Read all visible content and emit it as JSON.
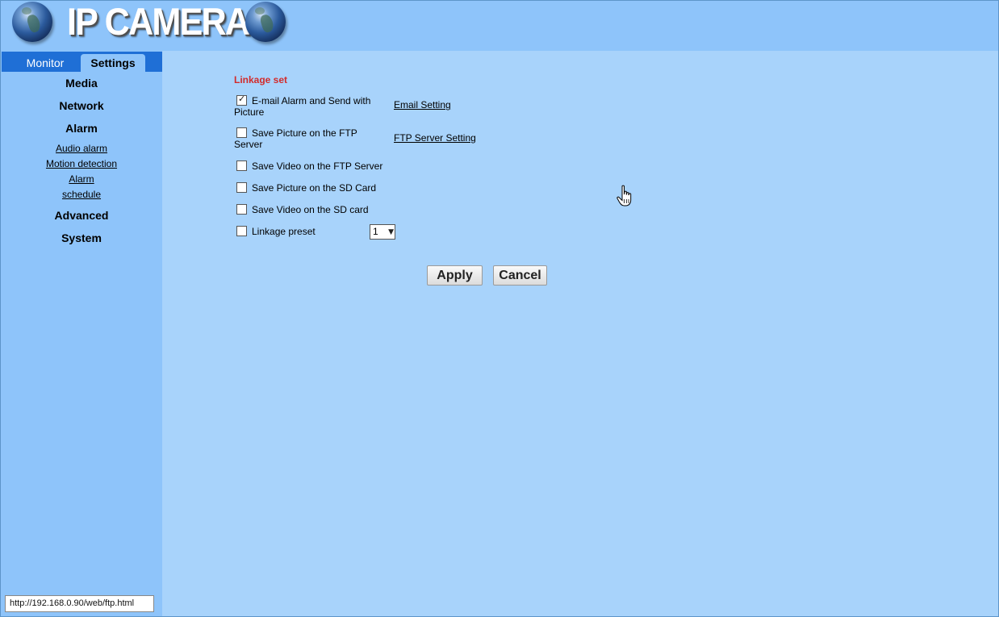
{
  "header": {
    "brand": "IP CAMERA",
    "left_icon": "globe-icon",
    "right_icon": "globe-icon"
  },
  "sidebar": {
    "tabs": [
      {
        "label": "Monitor",
        "active": false
      },
      {
        "label": "Settings",
        "active": true
      }
    ],
    "items": [
      {
        "label": "Media",
        "type": "main"
      },
      {
        "label": "Network",
        "type": "main"
      },
      {
        "label": "Alarm",
        "type": "main"
      },
      {
        "label": "Audio alarm",
        "type": "sub"
      },
      {
        "label": "Motion detection",
        "type": "sub"
      },
      {
        "label": "Alarm",
        "type": "sub"
      },
      {
        "label": "schedule",
        "type": "sub"
      },
      {
        "label": "Advanced",
        "type": "main"
      },
      {
        "label": "System",
        "type": "main"
      }
    ]
  },
  "main": {
    "section_title": "Linkage set",
    "options": [
      {
        "label_line1": "E-mail Alarm and Send with",
        "label_line2": "Picture",
        "checked": true
      },
      {
        "label_line1": "Save Picture on the FTP",
        "label_line2": "Server",
        "checked": false
      },
      {
        "label_line1": "Save Video on the FTP Server",
        "label_line2": "",
        "checked": false
      },
      {
        "label_line1": "Save Picture on the SD Card",
        "label_line2": "",
        "checked": false
      },
      {
        "label_line1": "Save Video on the SD card",
        "label_line2": "",
        "checked": false
      },
      {
        "label_line1": "Linkage preset",
        "label_line2": "",
        "checked": false
      }
    ],
    "links": {
      "email_setting": "Email Setting",
      "ftp_server_setting": "FTP Server Setting"
    },
    "preset_select": {
      "value": "1",
      "arrow_icon": "dropdown-arrow-icon"
    },
    "buttons": {
      "apply": "Apply",
      "cancel": "Cancel"
    },
    "cursor_icon": "hand-pointer-icon"
  },
  "statusbar": {
    "url": "http://192.168.0.90/web/ftp.html"
  },
  "colors": {
    "header_bg": "#8ec4fa",
    "content_bg": "#a8d3fb",
    "tab_bar_bg": "#1f6fd6",
    "section_title": "#d22b2b"
  }
}
